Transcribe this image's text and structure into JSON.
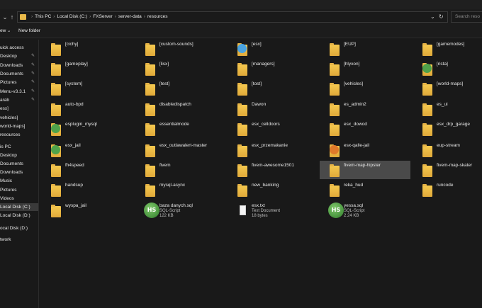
{
  "breadcrumb": [
    "This PC",
    "Local Disk (C:)",
    "FXServer",
    "server-data",
    "resources"
  ],
  "search": {
    "placeholder": "Search reso"
  },
  "toolbar": {
    "new": "ew",
    "new_folder": "New folder"
  },
  "nav": [
    {
      "label": "uick access",
      "pin": false
    },
    {
      "label": "Desktop",
      "pin": true
    },
    {
      "label": "Downloads",
      "pin": true
    },
    {
      "label": "Documents",
      "pin": true
    },
    {
      "label": "Pictures",
      "pin": true
    },
    {
      "label": "Menu-v3.3.1",
      "pin": true
    },
    {
      "label": "arab",
      "pin": true
    },
    {
      "label": "esx]",
      "pin": false
    },
    {
      "label": "vehicles]",
      "pin": false
    },
    {
      "label": "world-maps]",
      "pin": false
    },
    {
      "label": "resources",
      "pin": false
    },
    {
      "label": "is PC",
      "pin": false
    },
    {
      "label": "Desktop",
      "pin": false
    },
    {
      "label": "Documents",
      "pin": false
    },
    {
      "label": "Downloads",
      "pin": false
    },
    {
      "label": "Music",
      "pin": false
    },
    {
      "label": "Pictures",
      "pin": false
    },
    {
      "label": "Videos",
      "pin": false
    },
    {
      "label": "Local Disk (C:)",
      "pin": false,
      "selected": true
    },
    {
      "label": "Local Disk (D:)",
      "pin": false
    },
    {
      "label": "ocal Disk (D:)",
      "pin": false
    },
    {
      "label": "twork",
      "pin": false
    }
  ],
  "items": [
    {
      "name": "[cichy]",
      "type": "folder"
    },
    {
      "name": "[custom-sounds]",
      "type": "folder"
    },
    {
      "name": "[esx]",
      "type": "folder-blue"
    },
    {
      "name": "[EUP]",
      "type": "folder"
    },
    {
      "name": "[gamemodes]",
      "type": "folder"
    },
    {
      "name": "[gameplay]",
      "type": "folder"
    },
    {
      "name": "[lisx]",
      "type": "folder"
    },
    {
      "name": "[managers]",
      "type": "folder"
    },
    {
      "name": "[hlyxon]",
      "type": "folder"
    },
    {
      "name": "[rista]",
      "type": "folder-green"
    },
    {
      "name": "[system]",
      "type": "folder"
    },
    {
      "name": "[test]",
      "type": "folder"
    },
    {
      "name": "[tost]",
      "type": "folder"
    },
    {
      "name": "[vehicles]",
      "type": "folder"
    },
    {
      "name": "[world-maps]",
      "type": "folder"
    },
    {
      "name": "auto-bpd",
      "type": "folder"
    },
    {
      "name": "disabledispatch",
      "type": "folder"
    },
    {
      "name": "Dawon",
      "type": "folder"
    },
    {
      "name": "es_admin2",
      "type": "folder"
    },
    {
      "name": "es_ui",
      "type": "folder"
    },
    {
      "name": "esplugin_mysql",
      "type": "folder-green"
    },
    {
      "name": "essentialmode",
      "type": "folder"
    },
    {
      "name": "esx_celldoors",
      "type": "folder"
    },
    {
      "name": "esx_dowod",
      "type": "folder"
    },
    {
      "name": "esx_drp_garage",
      "type": "folder"
    },
    {
      "name": "esx_jail",
      "type": "folder-green"
    },
    {
      "name": "esx_outlawalert-master",
      "type": "folder"
    },
    {
      "name": "esx_przemakanie",
      "type": "folder"
    },
    {
      "name": "esx-qalle-jail",
      "type": "folder-orange"
    },
    {
      "name": "eup-stream",
      "type": "folder"
    },
    {
      "name": "fh4speed",
      "type": "folder"
    },
    {
      "name": "fivem",
      "type": "folder"
    },
    {
      "name": "fivem-awesome1501",
      "type": "folder"
    },
    {
      "name": "fivem-map-hipster",
      "type": "folder",
      "selected": true
    },
    {
      "name": "fivem-map-skater",
      "type": "folder"
    },
    {
      "name": "handsup",
      "type": "folder"
    },
    {
      "name": "mysql-async",
      "type": "folder"
    },
    {
      "name": "new_banking",
      "type": "folder"
    },
    {
      "name": "reka_hud",
      "type": "folder"
    },
    {
      "name": "runcode",
      "type": "folder"
    },
    {
      "name": "wyspa_jail",
      "type": "folder"
    },
    {
      "name": "baza danych.sql",
      "type": "sql",
      "kind": "SQL-Script",
      "size": "122 KB"
    },
    {
      "name": "esx.txt",
      "type": "txt",
      "kind": "Text Document",
      "size": "18 bytes"
    },
    {
      "name": "yessa.sql",
      "type": "sql",
      "kind": "SQL-Script",
      "size": "2.24 KB"
    }
  ],
  "icons": {
    "up": "up-arrow-icon",
    "refresh": "refresh-icon",
    "dropdown": "chevron-down-icon",
    "folder": "folder-icon",
    "sql": "heidisql-icon",
    "pin": "pin-icon"
  }
}
